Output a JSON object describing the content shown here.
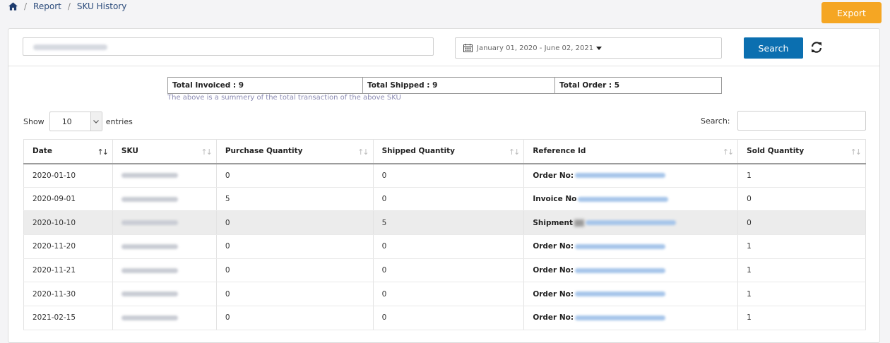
{
  "breadcrumb": {
    "items": [
      "Report",
      "SKU History"
    ]
  },
  "header": {
    "export_label": "Export"
  },
  "filters": {
    "date_range": "January 01, 2020 - June 02, 2021",
    "search_label": "Search"
  },
  "summary": {
    "total_invoiced": "Total Invoiced : 9",
    "total_shipped": "Total Shipped : 9",
    "total_order": "Total Order : 5",
    "note": "The above is a summery of the total transaction of the above SKU"
  },
  "table_controls": {
    "show_label": "Show",
    "entries_value": "10",
    "entries_label": "entries",
    "search_label": "Search:"
  },
  "table": {
    "columns": [
      "Date",
      "SKU",
      "Purchase Quantity",
      "Shipped Quantity",
      "Reference Id",
      "Sold Quantity"
    ],
    "rows": [
      {
        "date": "2020-01-10",
        "purchase": "0",
        "shipped": "0",
        "ref_label": "Order No:",
        "sold": "1"
      },
      {
        "date": "2020-09-01",
        "purchase": "5",
        "shipped": "0",
        "ref_label": "Invoice No",
        "sold": "0"
      },
      {
        "date": "2020-10-10",
        "purchase": "0",
        "shipped": "5",
        "ref_label": "Shipment",
        "sold": "0"
      },
      {
        "date": "2020-11-20",
        "purchase": "0",
        "shipped": "0",
        "ref_label": "Order No:",
        "sold": "1"
      },
      {
        "date": "2020-11-21",
        "purchase": "0",
        "shipped": "0",
        "ref_label": "Order No:",
        "sold": "1"
      },
      {
        "date": "2020-11-30",
        "purchase": "0",
        "shipped": "0",
        "ref_label": "Order No:",
        "sold": "1"
      },
      {
        "date": "2021-02-15",
        "purchase": "0",
        "shipped": "0",
        "ref_label": "Order No:",
        "sold": "1"
      }
    ]
  },
  "colors": {
    "export": "#f5a623",
    "search": "#0b6fb0",
    "link": "#4a90e2",
    "note": "#8b8bb3"
  }
}
